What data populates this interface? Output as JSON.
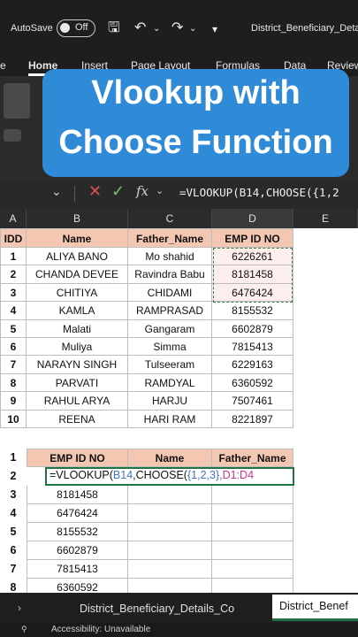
{
  "titlebar": {
    "autosave_label": "AutoSave",
    "autosave_state": "Off",
    "filename": "District_Beneficiary_Deta"
  },
  "ribbon": {
    "tabs": [
      "e",
      "Home",
      "Insert",
      "Page Layout",
      "Formulas",
      "Data",
      "Review"
    ],
    "active_tab": "Home"
  },
  "overlay": {
    "line1": "Vlookup with",
    "line2": "Choose Function",
    "color": "#2f8bd8"
  },
  "formula_bar": {
    "fx_label": "fx",
    "formula": "=VLOOKUP(B14,CHOOSE({1,2"
  },
  "columns": [
    "A",
    "B",
    "C",
    "D",
    "E"
  ],
  "table1": {
    "headers": [
      "IDD",
      "Name",
      "Father_Name",
      "EMP ID NO"
    ],
    "rows": [
      [
        "1",
        "ALIYA BANO",
        "Mo shahid",
        "6226261"
      ],
      [
        "2",
        "CHANDA DEVEE",
        "Ravindra Babu",
        "8181458"
      ],
      [
        "3",
        "CHITIYA",
        "CHIDAMI",
        "6476424"
      ],
      [
        "4",
        "KAMLA",
        "RAMPRASAD",
        "8155532"
      ],
      [
        "5",
        "Malati",
        "Gangaram",
        "6602879"
      ],
      [
        "6",
        "Muliya",
        "Simma",
        "7815413"
      ],
      [
        "7",
        "NARAYN SINGH",
        "Tulseeram",
        "6229163"
      ],
      [
        "8",
        "PARVATI",
        "RAMDYAL",
        "6360592"
      ],
      [
        "9",
        "RAHUL ARYA",
        "HARJU",
        "7507461"
      ],
      [
        "10",
        "REENA",
        "HARI RAM",
        "8221897"
      ]
    ]
  },
  "table2": {
    "header_rownum": "1",
    "headers": [
      "EMP ID NO",
      "Name",
      "Father_Name"
    ],
    "formula_rownum": "2",
    "formula_parts": {
      "p1": "=VLOOKUP(",
      "p2": "B14",
      "p3": ",CHOOSE(",
      "p4": "{1,2,3},",
      "p5": "D1:D4"
    },
    "rows": [
      [
        "3",
        "8181458"
      ],
      [
        "4",
        "6476424"
      ],
      [
        "5",
        "8155532"
      ],
      [
        "6",
        "6602879"
      ],
      [
        "7",
        "7815413"
      ],
      [
        "8",
        "6360592"
      ]
    ]
  },
  "sheet_tabs": {
    "tab1": "District_Beneficiary_Details_Co",
    "tab2": "District_Benef"
  },
  "statusbar": {
    "text": "Accessibility: Unavailable"
  }
}
